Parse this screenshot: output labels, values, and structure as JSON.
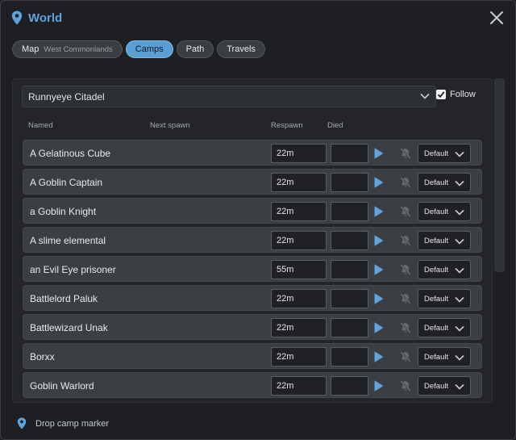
{
  "window": {
    "title": "World"
  },
  "tabs": [
    {
      "label": "Map",
      "sub": "West Commonlands",
      "active": false
    },
    {
      "label": "Camps",
      "active": true
    },
    {
      "label": "Path",
      "active": false
    },
    {
      "label": "Travels",
      "active": false
    }
  ],
  "zone_select": {
    "value": "Runnyeye Citadel"
  },
  "follow": {
    "label": "Follow",
    "checked": true
  },
  "columns": {
    "named": "Named",
    "next_spawn": "Next spawn",
    "respawn": "Respawn",
    "died": "Died"
  },
  "rows": [
    {
      "name": "A Gelatinous Cube",
      "respawn": "22m",
      "died": "",
      "alert": "Default"
    },
    {
      "name": "A Goblin Captain",
      "respawn": "22m",
      "died": "",
      "alert": "Default"
    },
    {
      "name": "a Goblin Knight",
      "respawn": "22m",
      "died": "",
      "alert": "Default"
    },
    {
      "name": "A slime elemental",
      "respawn": "22m",
      "died": "",
      "alert": "Default"
    },
    {
      "name": "an Evil Eye prisoner",
      "respawn": "55m",
      "died": "",
      "alert": "Default"
    },
    {
      "name": "Battlelord Paluk",
      "respawn": "22m",
      "died": "",
      "alert": "Default"
    },
    {
      "name": "Battlewizard Unak",
      "respawn": "22m",
      "died": "",
      "alert": "Default"
    },
    {
      "name": "Borxx",
      "respawn": "22m",
      "died": "",
      "alert": "Default"
    },
    {
      "name": "Goblin Warlord",
      "respawn": "22m",
      "died": "",
      "alert": "Default"
    }
  ],
  "footer": {
    "label": "Drop camp marker"
  },
  "icons": {
    "title": "map-pin-icon",
    "close": "close-icon",
    "dropdown": "chevron-down-icon",
    "check": "check-icon",
    "play": "play-icon",
    "bell": "bell-off-icon",
    "footer": "map-pin-icon"
  },
  "colors": {
    "accent": "#5ea3dc",
    "active_tab": "#5a9fd4",
    "background": "#1d1f23",
    "row": "#3b3e43"
  }
}
